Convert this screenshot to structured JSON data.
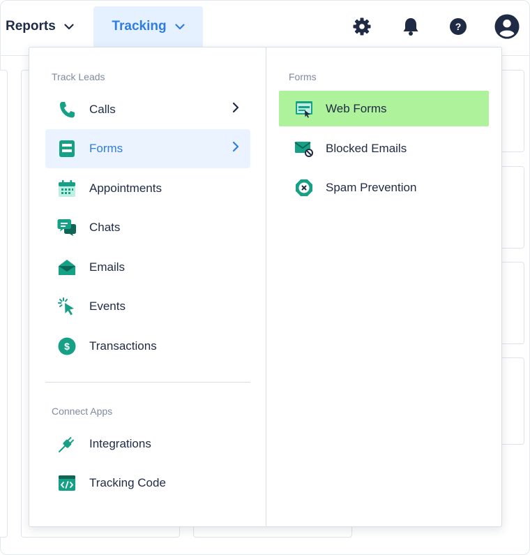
{
  "nav": {
    "reports_label": "Reports",
    "tracking_label": "Tracking"
  },
  "icons": {
    "settings": "gear-icon",
    "notifications": "bell-icon",
    "help": "help-icon",
    "account": "user-icon"
  },
  "colors": {
    "accent": "#2f7de1",
    "active_bg": "#eaf3ff",
    "icon_teal": "#16a085",
    "highlight": "#aef29c",
    "text_dark": "#1f2a44",
    "muted": "#7f8aa0"
  },
  "menu": {
    "track_leads_label": "Track Leads",
    "connect_apps_label": "Connect Apps",
    "items": [
      {
        "label": "Calls",
        "icon": "phone-icon"
      },
      {
        "label": "Forms",
        "icon": "form-icon"
      },
      {
        "label": "Appointments",
        "icon": "calendar-icon"
      },
      {
        "label": "Chats",
        "icon": "chat-icon"
      },
      {
        "label": "Emails",
        "icon": "envelope-icon"
      },
      {
        "label": "Events",
        "icon": "cursor-click-icon"
      },
      {
        "label": "Transactions",
        "icon": "dollar-icon"
      }
    ],
    "apps": [
      {
        "label": "Integrations",
        "icon": "plug-icon"
      },
      {
        "label": "Tracking Code",
        "icon": "code-icon"
      }
    ]
  },
  "submenu": {
    "label": "Forms",
    "items": [
      {
        "label": "Web Forms",
        "icon": "web-form-icon"
      },
      {
        "label": "Blocked Emails",
        "icon": "blocked-email-icon"
      },
      {
        "label": "Spam Prevention",
        "icon": "spam-prevention-icon"
      }
    ]
  }
}
